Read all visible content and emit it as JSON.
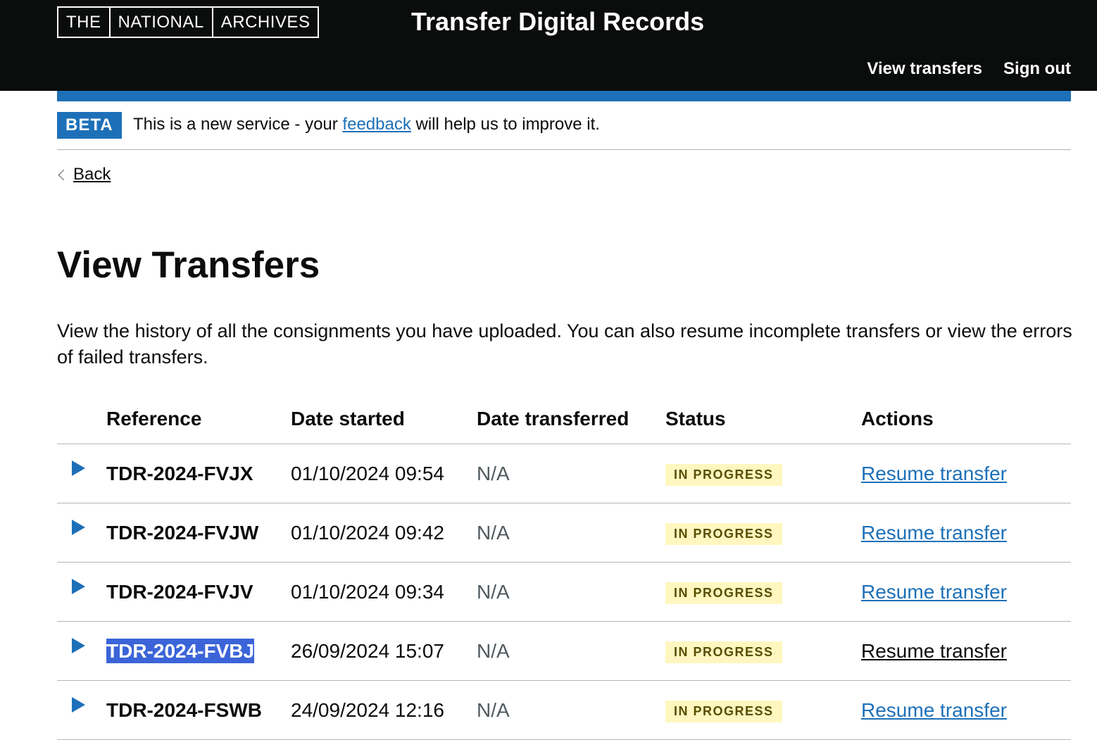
{
  "header": {
    "logo": [
      "THE",
      "NATIONAL",
      "ARCHIVES"
    ],
    "service_name": "Transfer Digital Records",
    "nav": [
      {
        "label": "View transfers"
      },
      {
        "label": "Sign out"
      }
    ]
  },
  "phase_banner": {
    "tag": "BETA",
    "text_before": "This is a new service - your ",
    "link": "feedback",
    "text_after": " will help us to improve it."
  },
  "back_link": "Back",
  "page": {
    "title": "View Transfers",
    "intro": "View the history of all the consignments you have uploaded. You can also resume incomplete transfers or view the errors of failed transfers."
  },
  "table": {
    "headers": [
      "Reference",
      "Date started",
      "Date transferred",
      "Status",
      "Actions"
    ],
    "rows": [
      {
        "reference": "TDR-2024-FVJX",
        "date_started": "01/10/2024 09:54",
        "date_transferred": "N/A",
        "status": "IN PROGRESS",
        "action": "Resume transfer"
      },
      {
        "reference": "TDR-2024-FVJW",
        "date_started": "01/10/2024 09:42",
        "date_transferred": "N/A",
        "status": "IN PROGRESS",
        "action": "Resume transfer"
      },
      {
        "reference": "TDR-2024-FVJV",
        "date_started": "01/10/2024 09:34",
        "date_transferred": "N/A",
        "status": "IN PROGRESS",
        "action": "Resume transfer"
      },
      {
        "reference": "TDR-2024-FVBJ",
        "date_started": "26/09/2024 15:07",
        "date_transferred": "N/A",
        "status": "IN PROGRESS",
        "action": "Resume transfer"
      },
      {
        "reference": "TDR-2024-FSWB",
        "date_started": "24/09/2024 12:16",
        "date_transferred": "N/A",
        "status": "IN PROGRESS",
        "action": "Resume transfer"
      }
    ]
  },
  "colors": {
    "header_bg": "#0b0c0c",
    "accent_blue": "#1d70b8",
    "status_tag_bg": "#fff7bf",
    "status_tag_text": "#594d00",
    "selection": "#3b64d8"
  }
}
